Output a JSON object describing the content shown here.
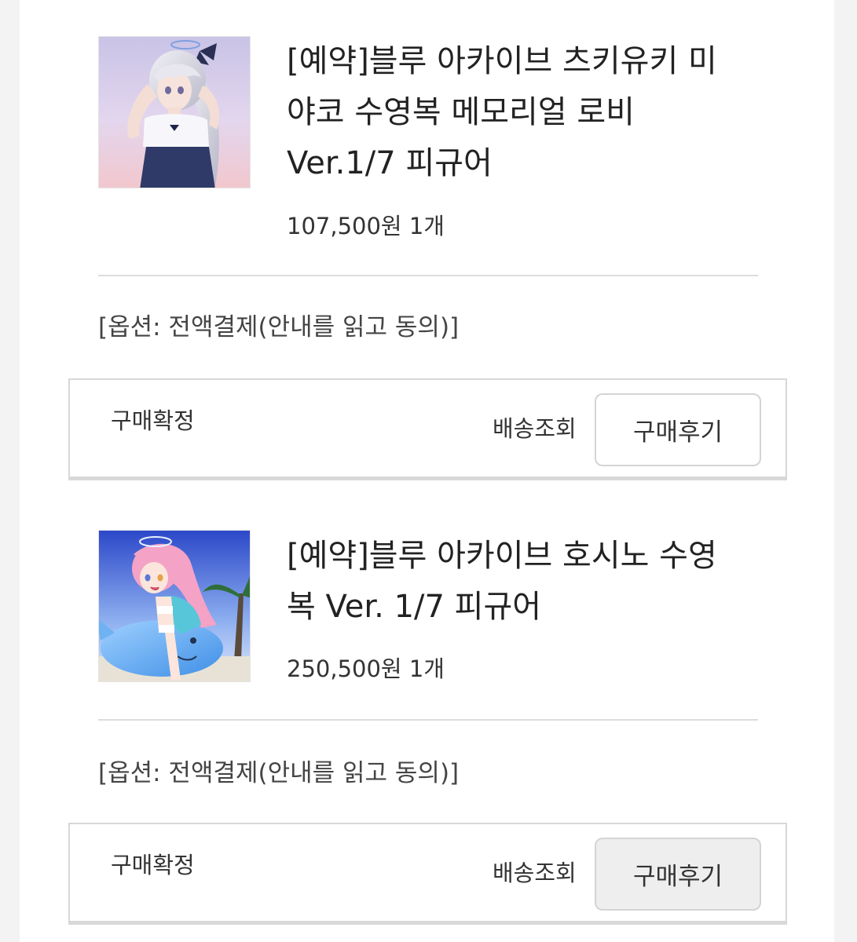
{
  "orders": [
    {
      "title": "[예약]블루 아카이브 츠키유키 미야코 수영복 메모리얼 로비 Ver.1/7 피규어",
      "title_lines": [
        "[예약]블루 아카이브 츠키유키 미",
        "야코 수영복 메모리얼 로비",
        "Ver.1/7 피규어"
      ],
      "price_quantity": "107,500원 1개",
      "option": "[옵션: 전액결제(안내를 읽고 동의)]",
      "confirm_label": "구매확정",
      "tracking_label": "배송조회",
      "review_label": "구매후기"
    },
    {
      "title": "[예약]블루 아카이브 호시노 수영복 Ver. 1/7 피규어",
      "title_lines": [
        "[예약]블루 아카이브 호시노 수영",
        "복 Ver. 1/7 피규어"
      ],
      "price_quantity": "250,500원 1개",
      "option": "[옵션: 전액결제(안내를 읽고 동의)]",
      "confirm_label": "구매확정",
      "tracking_label": "배송조회",
      "review_label": "구매후기"
    }
  ]
}
